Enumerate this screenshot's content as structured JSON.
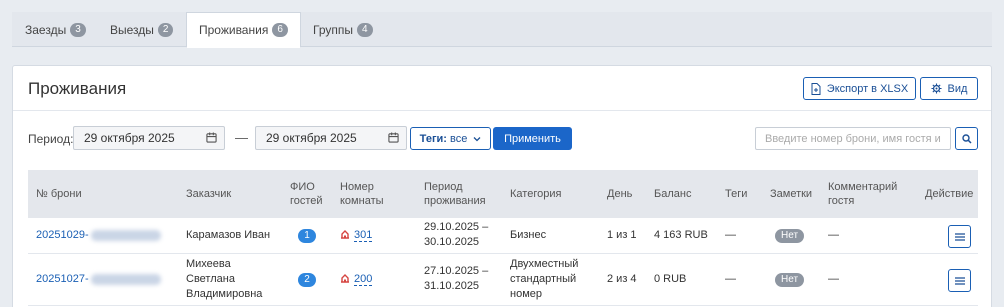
{
  "tabs": [
    {
      "label": "Заезды",
      "count": "3"
    },
    {
      "label": "Выезды",
      "count": "2"
    },
    {
      "label": "Проживания",
      "count": "6"
    },
    {
      "label": "Группы",
      "count": "4"
    }
  ],
  "panel": {
    "title": "Проживания",
    "export_label": "Экспорт в XLSX",
    "view_label": "Вид"
  },
  "filters": {
    "period_label": "Период:",
    "date_from": "29 октября 2025",
    "separator": "—",
    "date_to": "29 октября 2025",
    "tags_prefix": "Теги:",
    "tags_value": "все",
    "apply_label": "Применить",
    "search_placeholder": "Введите номер брони, имя гостя и"
  },
  "table": {
    "headers": {
      "booking": "№ брони",
      "customer": "Заказчик",
      "guests": "ФИО гостей",
      "room": "Номер комнаты",
      "period": "Период проживания",
      "category": "Категория",
      "day": "День",
      "balance": "Баланс",
      "tags": "Теги",
      "notes": "Заметки",
      "comment": "Комментарий гостя",
      "action": "Действие"
    },
    "rows": [
      {
        "booking": "20251029-",
        "customer": "Карамазов Иван",
        "guests": "1",
        "room": "301",
        "period_from": "29.10.2025 –",
        "period_to": "30.10.2025",
        "category": "Бизнес",
        "day": "1 из 1",
        "balance": "4 163 RUB",
        "tags": "—",
        "notes": "Нет",
        "comment": "—"
      },
      {
        "booking": "20251027-",
        "customer": "Михеева Светлана Владимировна",
        "guests": "2",
        "room": "200",
        "period_from": "27.10.2025 –",
        "period_to": "31.10.2025",
        "category": "Двухместный стандартный номер",
        "day": "2 из 4",
        "balance": "0 RUB",
        "tags": "—",
        "notes": "Нет",
        "comment": "—"
      }
    ]
  },
  "colors": {
    "accent": "#1b66c9",
    "badge": "#8e96a1",
    "guest_badge": "#2e86de",
    "room_icon": "#d64541"
  }
}
